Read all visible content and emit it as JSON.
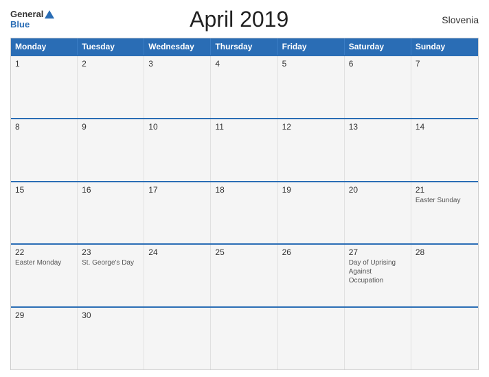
{
  "header": {
    "logo_general": "General",
    "logo_blue": "Blue",
    "title": "April 2019",
    "country": "Slovenia"
  },
  "weekdays": [
    "Monday",
    "Tuesday",
    "Wednesday",
    "Thursday",
    "Friday",
    "Saturday",
    "Sunday"
  ],
  "weeks": [
    [
      {
        "day": "1",
        "event": ""
      },
      {
        "day": "2",
        "event": ""
      },
      {
        "day": "3",
        "event": ""
      },
      {
        "day": "4",
        "event": ""
      },
      {
        "day": "5",
        "event": ""
      },
      {
        "day": "6",
        "event": ""
      },
      {
        "day": "7",
        "event": ""
      }
    ],
    [
      {
        "day": "8",
        "event": ""
      },
      {
        "day": "9",
        "event": ""
      },
      {
        "day": "10",
        "event": ""
      },
      {
        "day": "11",
        "event": ""
      },
      {
        "day": "12",
        "event": ""
      },
      {
        "day": "13",
        "event": ""
      },
      {
        "day": "14",
        "event": ""
      }
    ],
    [
      {
        "day": "15",
        "event": ""
      },
      {
        "day": "16",
        "event": ""
      },
      {
        "day": "17",
        "event": ""
      },
      {
        "day": "18",
        "event": ""
      },
      {
        "day": "19",
        "event": ""
      },
      {
        "day": "20",
        "event": ""
      },
      {
        "day": "21",
        "event": "Easter Sunday"
      }
    ],
    [
      {
        "day": "22",
        "event": "Easter Monday"
      },
      {
        "day": "23",
        "event": "St. George's Day"
      },
      {
        "day": "24",
        "event": ""
      },
      {
        "day": "25",
        "event": ""
      },
      {
        "day": "26",
        "event": ""
      },
      {
        "day": "27",
        "event": "Day of Uprising Against Occupation"
      },
      {
        "day": "28",
        "event": ""
      }
    ],
    [
      {
        "day": "29",
        "event": ""
      },
      {
        "day": "30",
        "event": ""
      },
      {
        "day": "",
        "event": ""
      },
      {
        "day": "",
        "event": ""
      },
      {
        "day": "",
        "event": ""
      },
      {
        "day": "",
        "event": ""
      },
      {
        "day": "",
        "event": ""
      }
    ]
  ]
}
